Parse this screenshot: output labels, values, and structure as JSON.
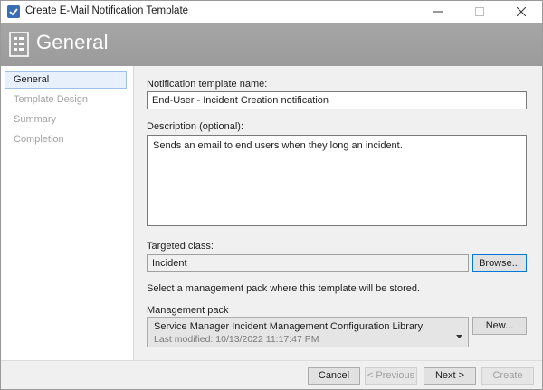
{
  "window": {
    "title": "Create E-Mail Notification Template"
  },
  "header": {
    "title": "General"
  },
  "nav": {
    "items": [
      {
        "label": "General"
      },
      {
        "label": "Template Design"
      },
      {
        "label": "Summary"
      },
      {
        "label": "Completion"
      }
    ]
  },
  "form": {
    "name_label": "Notification template name:",
    "name_value": "End-User - Incident Creation notification",
    "description_label": "Description (optional):",
    "description_value": "Sends an email to end users when they long an incident.",
    "class_label": "Targeted class:",
    "class_value": "Incident",
    "browse_label": "Browse...",
    "mp_instruction": "Select a management pack where this template will be stored.",
    "mp_label": "Management pack",
    "mp_name": "Service Manager Incident Management Configuration Library",
    "mp_modified": "Last modified:  10/13/2022 11:17:47 PM",
    "new_label": "New..."
  },
  "footer": {
    "cancel_label": "Cancel",
    "previous_label": "< Previous",
    "next_label": "Next >",
    "create_label": "Create"
  },
  "icons": {
    "app": "notification-template-icon",
    "header": "form-template-icon"
  },
  "colors": {
    "header_bg": "#9e9e9e",
    "nav_active_bg": "#e7f0fb",
    "nav_active_border": "#9fc1e8",
    "focus_border": "#0078d7"
  }
}
